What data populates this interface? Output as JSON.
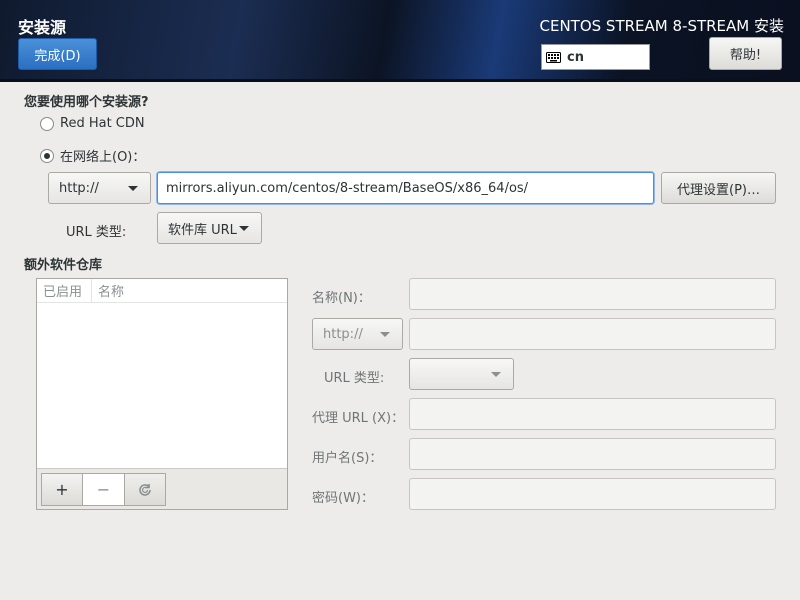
{
  "header": {
    "title": "安装源",
    "done_label": "完成(D)",
    "product": "CENTOS STREAM 8-STREAM 安装",
    "keyboard_layout": "cn",
    "help_label": "帮助!"
  },
  "source": {
    "question": "您要使用哪个安装源?",
    "option_cdn": "Red Hat CDN",
    "option_network": "在网络上(O)：",
    "selected": "network",
    "protocol": "http://",
    "url": "mirrors.aliyun.com/centos/8-stream/BaseOS/x86_64/os/",
    "proxy_label": "代理设置(P)…",
    "url_type_label": "URL 类型:",
    "url_type_value": "软件库 URL"
  },
  "extra_repos": {
    "section_label": "额外软件仓库",
    "columns": [
      "已启用",
      "名称"
    ],
    "add_label": "+",
    "remove_label": "−",
    "refresh_icon": "refresh-icon"
  },
  "repo_form": {
    "name_label": "名称(N)：",
    "protocol": "http://",
    "url_type_label": "URL 类型:",
    "proxy_url_label": "代理 URL (X)：",
    "username_label": "用户名(S)：",
    "password_label": "密码(W)："
  }
}
